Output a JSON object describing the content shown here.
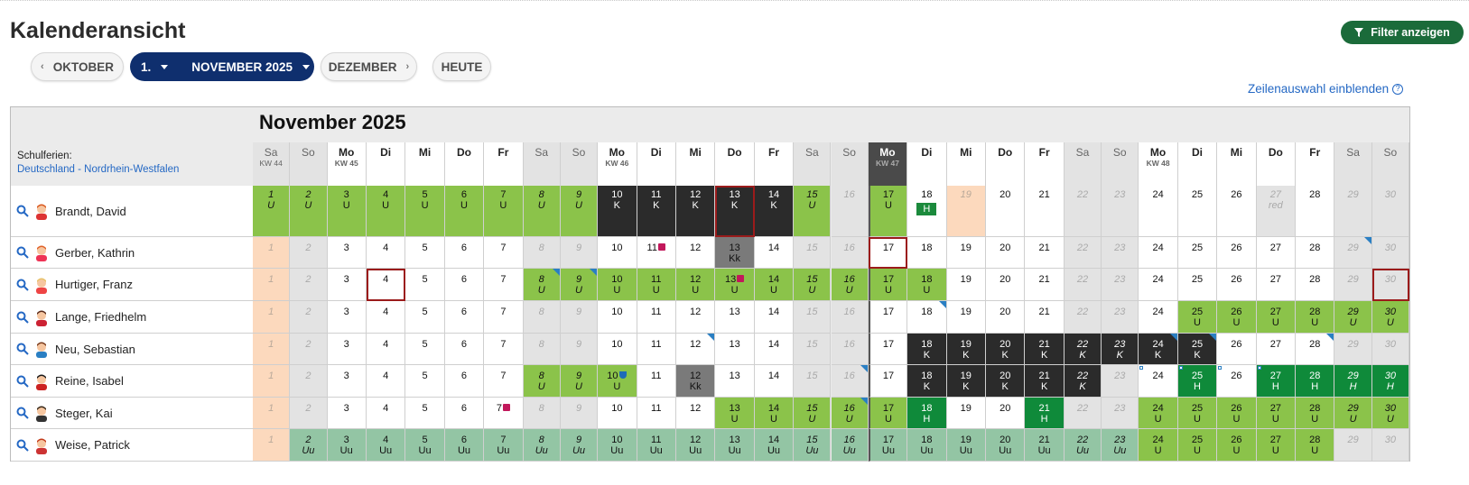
{
  "page": {
    "title": "Kalenderansicht",
    "filter_label": "Filter anzeigen",
    "zeilenauswahl": "Zeilenauswahl einblenden"
  },
  "nav": {
    "prev": "OKTOBER",
    "day": "1.",
    "current": "NOVEMBER 2025",
    "next": "DEZEMBER",
    "today": "HEUTE"
  },
  "calendar": {
    "month_title": "November 2025",
    "schulferien_label": "Schulferien:",
    "schulferien_region": "Deutschland - Nordrhein-Westfalen",
    "days": [
      {
        "n": 1,
        "dn": "Sa",
        "kw": "KW 44",
        "t": "we"
      },
      {
        "n": 2,
        "dn": "So",
        "t": "we"
      },
      {
        "n": 3,
        "dn": "Mo",
        "kw": "KW 45",
        "t": "wd"
      },
      {
        "n": 4,
        "dn": "Di",
        "t": "wd"
      },
      {
        "n": 5,
        "dn": "Mi",
        "t": "wd"
      },
      {
        "n": 6,
        "dn": "Do",
        "t": "wd"
      },
      {
        "n": 7,
        "dn": "Fr",
        "t": "wd"
      },
      {
        "n": 8,
        "dn": "Sa",
        "t": "we"
      },
      {
        "n": 9,
        "dn": "So",
        "t": "we"
      },
      {
        "n": 10,
        "dn": "Mo",
        "kw": "KW 46",
        "t": "wd"
      },
      {
        "n": 11,
        "dn": "Di",
        "t": "wd"
      },
      {
        "n": 12,
        "dn": "Mi",
        "t": "wd"
      },
      {
        "n": 13,
        "dn": "Do",
        "t": "wd"
      },
      {
        "n": 14,
        "dn": "Fr",
        "t": "wd"
      },
      {
        "n": 15,
        "dn": "Sa",
        "t": "we"
      },
      {
        "n": 16,
        "dn": "So",
        "t": "we"
      },
      {
        "n": 17,
        "dn": "Mo",
        "kw": "KW 47",
        "t": "today"
      },
      {
        "n": 18,
        "dn": "Di",
        "t": "wd"
      },
      {
        "n": 19,
        "dn": "Mi",
        "t": "wd"
      },
      {
        "n": 20,
        "dn": "Do",
        "t": "wd"
      },
      {
        "n": 21,
        "dn": "Fr",
        "t": "wd"
      },
      {
        "n": 22,
        "dn": "Sa",
        "t": "we"
      },
      {
        "n": 23,
        "dn": "So",
        "t": "we"
      },
      {
        "n": 24,
        "dn": "Mo",
        "kw": "KW 48",
        "t": "wd"
      },
      {
        "n": 25,
        "dn": "Di",
        "t": "wd"
      },
      {
        "n": 26,
        "dn": "Mi",
        "t": "wd"
      },
      {
        "n": 27,
        "dn": "Do",
        "t": "wd"
      },
      {
        "n": 28,
        "dn": "Fr",
        "t": "wd"
      },
      {
        "n": 29,
        "dn": "Sa",
        "t": "we"
      },
      {
        "n": 30,
        "dn": "So",
        "t": "we"
      }
    ],
    "rows": [
      {
        "name": "Brandt, David",
        "avatar": "red-hair-man",
        "cells": {
          "1": "g:U",
          "2": "g:U",
          "3": "g:U",
          "4": "g:U",
          "5": "g:U",
          "6": "g:U",
          "7": "g:U",
          "8": "g:U",
          "9": "g:U",
          "10": "k:K",
          "11": "k:K",
          "12": "k:K",
          "13": "k:K:red",
          "14": "k:K",
          "15": "g:U",
          "17": "g:U",
          "18": "w:H:badge",
          "19": "p",
          "27": "we:red"
        }
      },
      {
        "name": "Gerber, Kathrin",
        "avatar": "red-hair-woman",
        "cells": {
          "1": "p",
          "11": "w::gift",
          "13": "gr:Kk",
          "17": "w::red",
          "29": "we::tri"
        }
      },
      {
        "name": "Hurtiger, Franz",
        "avatar": "blond-man",
        "cells": {
          "1": "p",
          "4": "w::red",
          "8": "g:U:tri",
          "9": "g:U:tri",
          "10": "g:U",
          "11": "g:U",
          "12": "g:U",
          "13": "g:U:gift",
          "14": "g:U",
          "15": "g:U",
          "16": "g:U",
          "17": "g:U",
          "18": "g:U",
          "30": "we::red"
        }
      },
      {
        "name": "Lange, Friedhelm",
        "avatar": "dark-hair-man",
        "cells": {
          "1": "p",
          "18": "w::tri",
          "25": "g:U",
          "26": "g:U",
          "27": "g:U",
          "28": "g:U",
          "29": "g:U",
          "30": "g:U"
        }
      },
      {
        "name": "Neu, Sebastian",
        "avatar": "brown-hair-man",
        "cells": {
          "1": "p",
          "12": "w::tri",
          "18": "k:K",
          "19": "k:K",
          "20": "k:K",
          "21": "k:K",
          "22": "k:K",
          "23": "k:K",
          "24": "k:K:tri",
          "25": "k:K:tri",
          "28": "w::tri"
        }
      },
      {
        "name": "Reine, Isabel",
        "avatar": "black-hair-woman",
        "cells": {
          "1": "p",
          "8": "g:U",
          "9": "g:U",
          "10": "g:U:trophy",
          "12": "gr:Kk",
          "16": "we::tri",
          "18": "k:K",
          "19": "k:K",
          "20": "k:K",
          "21": "k:K",
          "22": "k:K",
          "24": "w::sq",
          "25": "dg:H:sq",
          "26": "w::sq",
          "27": "dg:H:sq",
          "28": "dg:H",
          "29": "dg:H",
          "30": "dg:H"
        }
      },
      {
        "name": "Steger, Kai",
        "avatar": "suit-man",
        "cells": {
          "1": "p",
          "7": "w::gift",
          "13": "g:U",
          "14": "g:U",
          "15": "g:U",
          "16": "g:U:tri",
          "17": "g:U",
          "18": "dg:H",
          "21": "dg:H",
          "24": "g:U",
          "25": "g:U",
          "26": "g:U",
          "27": "g:U",
          "28": "g:U",
          "29": "g:U",
          "30": "g:U"
        }
      },
      {
        "name": "Weise, Patrick",
        "avatar": "red-hair-man2",
        "cells": {
          "1": "p",
          "2": "t:Uu",
          "3": "t:Uu",
          "4": "t:Uu",
          "5": "t:Uu",
          "6": "t:Uu",
          "7": "t:Uu",
          "8": "t:Uu",
          "9": "t:Uu",
          "10": "t:Uu",
          "11": "t:Uu",
          "12": "t:Uu",
          "13": "t:Uu",
          "14": "t:Uu",
          "15": "t:Uu",
          "16": "t:Uu",
          "17": "t:Uu",
          "18": "t:Uu",
          "19": "t:Uu",
          "20": "t:Uu",
          "21": "t:Uu",
          "22": "t:Uu",
          "23": "t:Uu",
          "24": "g:U",
          "25": "g:U",
          "26": "g:U",
          "27": "g:U",
          "28": "g:U"
        }
      }
    ]
  },
  "colors": {
    "green": "#8bc34a",
    "dark_green": "#0f8a3a",
    "black": "#2b2b2b",
    "gray": "#7a7a7a",
    "peach": "#fcd9bd",
    "teal": "#93c5a4",
    "weekend": "#e3e3e3",
    "navy": "#0f2f6e",
    "filter": "#1b6b3a"
  }
}
